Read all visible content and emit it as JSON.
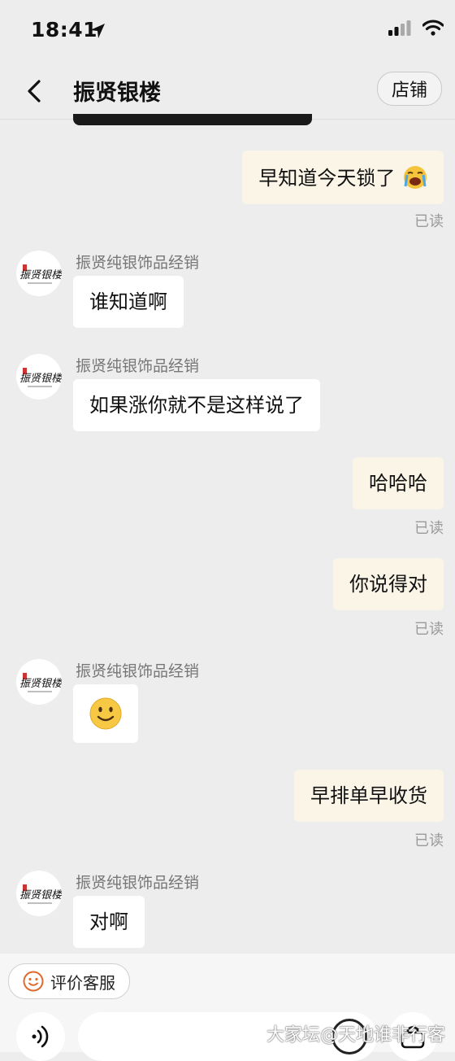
{
  "status_bar": {
    "time": "18:41"
  },
  "nav": {
    "title": "振贤银楼",
    "shop_label": "店铺"
  },
  "messages": [
    {
      "dir": "out",
      "text": "早知道今天锁了",
      "read": "已读"
    },
    {
      "dir": "in",
      "sender": "振贤纯银饰品经销",
      "text": "谁知道啊"
    },
    {
      "dir": "in",
      "sender": "振贤纯银饰品经销",
      "text": "如果涨你就不是这样说了"
    },
    {
      "dir": "out",
      "text": "哈哈哈",
      "read": "已读"
    },
    {
      "dir": "out",
      "text": "你说得对",
      "read": "已读"
    },
    {
      "dir": "in",
      "sender": "振贤纯银饰品经销",
      "text": ""
    },
    {
      "dir": "out",
      "text": "早排单早收货",
      "read": "已读"
    },
    {
      "dir": "in",
      "sender": "振贤纯银饰品经销",
      "text": "对啊"
    }
  ],
  "avatar_logo": "振贤银楼",
  "bottom": {
    "rate_label": "评价客服",
    "input_placeholder": ""
  },
  "watermark": "大家坛@天地谁非行客",
  "colors": {
    "bg": "#ededed",
    "bubble_out": "#fbf5e8",
    "bubble_in": "#ffffff",
    "rate_icon": "#e06a2c"
  },
  "icons": [
    "back-arrow-icon",
    "location-arrow-icon",
    "signal-icon",
    "wifi-icon",
    "crying-emoji-icon",
    "smile-emoji-icon",
    "smile-rate-icon",
    "voice-icon",
    "emoji-icon",
    "more-icon"
  ]
}
